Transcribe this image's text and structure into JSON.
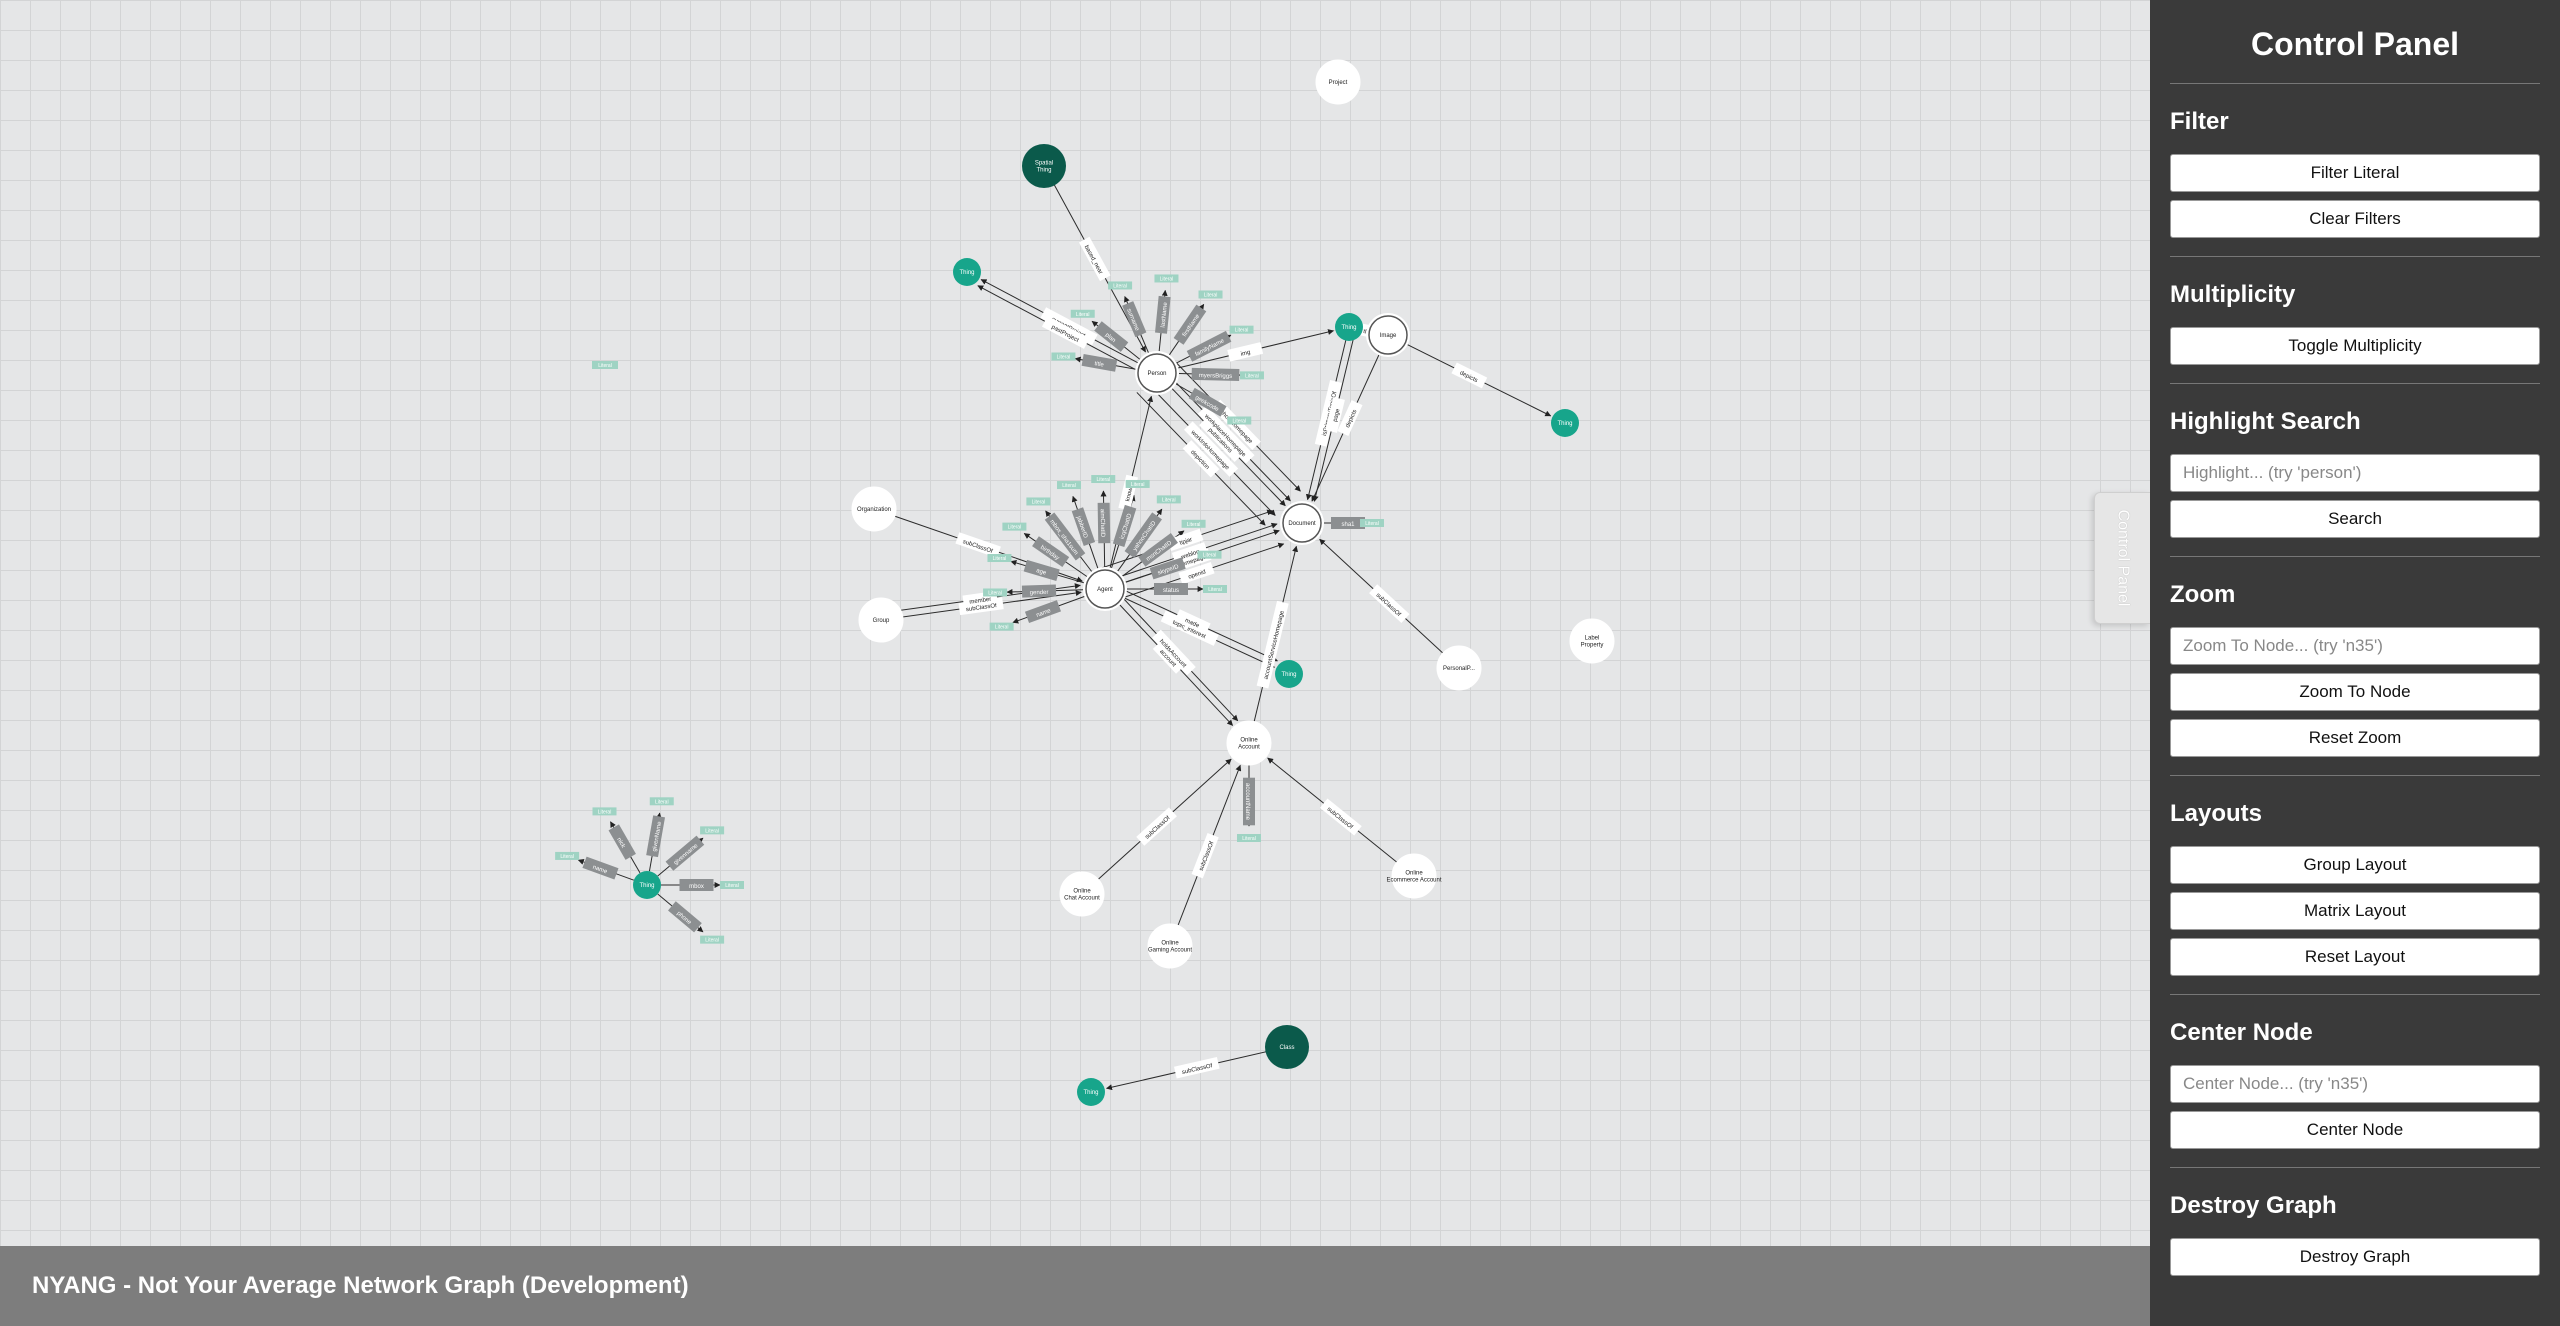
{
  "footer": {
    "title": "NYANG - Not Your Average Network Graph (Development)"
  },
  "panel_tab": {
    "label": "Control Panel"
  },
  "panel": {
    "title": "Control Panel",
    "filter": {
      "heading": "Filter",
      "filter_literal": "Filter Literal",
      "clear_filters": "Clear Filters"
    },
    "multiplicity": {
      "heading": "Multiplicity",
      "toggle": "Toggle Multiplicity"
    },
    "highlight": {
      "heading": "Highlight Search",
      "placeholder": "Highlight... (try 'person')",
      "value": "",
      "search": "Search"
    },
    "zoom": {
      "heading": "Zoom",
      "placeholder": "Zoom To Node... (try 'n35')",
      "value": "",
      "zoom_to_node": "Zoom To Node",
      "reset_zoom": "Reset Zoom"
    },
    "layouts": {
      "heading": "Layouts",
      "group": "Group Layout",
      "matrix": "Matrix Layout",
      "reset": "Reset Layout"
    },
    "center": {
      "heading": "Center Node",
      "placeholder": "Center Node... (try 'n35')",
      "value": "",
      "center_node": "Center Node"
    },
    "destroy": {
      "heading": "Destroy Graph",
      "destroy_graph": "Destroy Graph"
    }
  },
  "colors": {
    "node_white": "#ffffff",
    "node_teal": "#17a58b",
    "node_dark": "#0b5a4b",
    "edge_label_box": "#8c8f91",
    "literal_box": "#9fd3c3",
    "footer_bg": "#7d7d7d",
    "panel_bg": "#3a3a3a",
    "canvas_bg": "#e5e6e7"
  },
  "graph": {
    "nodes": [
      {
        "id": "proj",
        "label": "Project",
        "kind": "white"
      },
      {
        "id": "spatial",
        "label": "Spatial Thing",
        "kind": "dark"
      },
      {
        "id": "t1",
        "label": "Thing",
        "kind": "teal"
      },
      {
        "id": "person",
        "label": "Person",
        "kind": "ring"
      },
      {
        "id": "t2",
        "label": "Thing",
        "kind": "teal"
      },
      {
        "id": "image",
        "label": "Image",
        "kind": "ring"
      },
      {
        "id": "t3",
        "label": "Thing",
        "kind": "teal"
      },
      {
        "id": "org",
        "label": "Organization",
        "kind": "white"
      },
      {
        "id": "doc",
        "label": "Document",
        "kind": "ring"
      },
      {
        "id": "agent",
        "label": "Agent",
        "kind": "ring"
      },
      {
        "id": "group",
        "label": "Group",
        "kind": "white"
      },
      {
        "id": "t4",
        "label": "Thing",
        "kind": "teal"
      },
      {
        "id": "persdoc",
        "label": "PersonalP...",
        "kind": "white"
      },
      {
        "id": "labelprop",
        "label": "Label Property",
        "kind": "white"
      },
      {
        "id": "online",
        "label": "Online Account",
        "kind": "white"
      },
      {
        "id": "t5",
        "label": "Thing",
        "kind": "teal"
      },
      {
        "id": "ochat",
        "label": "Online Chat Account",
        "kind": "white"
      },
      {
        "id": "ogame",
        "label": "Online Gaming Account",
        "kind": "white"
      },
      {
        "id": "oecom",
        "label": "Online Ecommerce Account",
        "kind": "white"
      },
      {
        "id": "class",
        "label": "Class",
        "kind": "dark"
      },
      {
        "id": "t6",
        "label": "Thing",
        "kind": "teal"
      }
    ],
    "edges": [
      {
        "from": "spatial",
        "to": "person",
        "label": "based_near"
      },
      {
        "from": "person",
        "to": "t1",
        "label": "currentProject"
      },
      {
        "from": "person",
        "to": "t1",
        "label": "pastProject"
      },
      {
        "from": "person",
        "to": "t2",
        "label": "img"
      },
      {
        "from": "person",
        "to": "doc",
        "label": "publications"
      },
      {
        "from": "person",
        "to": "doc",
        "label": "workplaceHomepage"
      },
      {
        "from": "person",
        "to": "doc",
        "label": "workInfoHomepage"
      },
      {
        "from": "person",
        "to": "doc",
        "label": "schoolHomepage"
      },
      {
        "from": "person",
        "to": "doc",
        "label": "depiction"
      },
      {
        "from": "image",
        "to": "t2",
        "label": "thumbnail"
      },
      {
        "from": "image",
        "to": "t3",
        "label": "depicts"
      },
      {
        "from": "image",
        "to": "doc",
        "label": "depicts"
      },
      {
        "from": "t2",
        "to": "doc",
        "label": "isPrimaryTopicOf"
      },
      {
        "from": "t2",
        "to": "doc",
        "label": "page"
      },
      {
        "from": "org",
        "to": "agent",
        "label": "subClassOf"
      },
      {
        "from": "group",
        "to": "agent",
        "label": "subClassOf"
      },
      {
        "from": "group",
        "to": "agent",
        "label": "member"
      },
      {
        "from": "agent",
        "to": "doc",
        "label": "homepage"
      },
      {
        "from": "agent",
        "to": "doc",
        "label": "weblog"
      },
      {
        "from": "agent",
        "to": "doc",
        "label": "openid"
      },
      {
        "from": "agent",
        "to": "doc",
        "label": "tipjar"
      },
      {
        "from": "agent",
        "to": "t4",
        "label": "topic_interest"
      },
      {
        "from": "agent",
        "to": "t4",
        "label": "made"
      },
      {
        "from": "agent",
        "to": "online",
        "label": "account"
      },
      {
        "from": "agent",
        "to": "online",
        "label": "holdsAccount"
      },
      {
        "from": "agent",
        "to": "person",
        "label": "knows"
      },
      {
        "from": "online",
        "to": "doc",
        "label": "accountServiceHomepage"
      },
      {
        "from": "persdoc",
        "to": "doc",
        "label": "subClassOf"
      },
      {
        "from": "ochat",
        "to": "online",
        "label": "subClassOf"
      },
      {
        "from": "ogame",
        "to": "online",
        "label": "subClassOf"
      },
      {
        "from": "oecom",
        "to": "online",
        "label": "subClassOf"
      },
      {
        "from": "class",
        "to": "t6",
        "label": "subClassOf"
      }
    ],
    "literals": [
      {
        "node": "person",
        "label": "Literal",
        "edge": "title"
      },
      {
        "node": "person",
        "label": "Literal",
        "edge": "plan"
      },
      {
        "node": "person",
        "label": "Literal",
        "edge": "surname"
      },
      {
        "node": "person",
        "label": "Literal",
        "edge": "lastName"
      },
      {
        "node": "person",
        "label": "Literal",
        "edge": "firstName"
      },
      {
        "node": "person",
        "label": "Literal",
        "edge": "familyName"
      },
      {
        "node": "person",
        "label": "Literal",
        "edge": "myersBriggs"
      },
      {
        "node": "person",
        "label": "Literal",
        "edge": "geekcode"
      },
      {
        "node": "doc",
        "label": "Literal",
        "edge": "sha1"
      },
      {
        "node": "agent",
        "label": "Literal",
        "edge": "name"
      },
      {
        "node": "agent",
        "label": "Literal",
        "edge": "gender"
      },
      {
        "node": "agent",
        "label": "Literal",
        "edge": "age"
      },
      {
        "node": "agent",
        "label": "Literal",
        "edge": "birthday"
      },
      {
        "node": "agent",
        "label": "Literal",
        "edge": "mbox_sha1sum"
      },
      {
        "node": "agent",
        "label": "Literal",
        "edge": "jabberID"
      },
      {
        "node": "agent",
        "label": "Literal",
        "edge": "aimChatID"
      },
      {
        "node": "agent",
        "label": "Literal",
        "edge": "icqChatID"
      },
      {
        "node": "agent",
        "label": "Literal",
        "edge": "yahooChatID"
      },
      {
        "node": "agent",
        "label": "Literal",
        "edge": "msnChatID"
      },
      {
        "node": "agent",
        "label": "Literal",
        "edge": "skypeID"
      },
      {
        "node": "agent",
        "label": "Literal",
        "edge": "status"
      },
      {
        "node": "online",
        "label": "Literal",
        "edge": "accountName"
      },
      {
        "node": "t5",
        "label": "Literal",
        "edge": "name"
      },
      {
        "node": "t5",
        "label": "Literal",
        "edge": "nick"
      },
      {
        "node": "t5",
        "label": "Literal",
        "edge": "givenName"
      },
      {
        "node": "t5",
        "label": "Literal",
        "edge": "givenname"
      },
      {
        "node": "t5",
        "label": "Literal",
        "edge": "mbox"
      },
      {
        "node": "t5",
        "label": "Literal",
        "edge": "phone"
      }
    ],
    "floating_literals": [
      {
        "label": "Literal"
      }
    ]
  }
}
